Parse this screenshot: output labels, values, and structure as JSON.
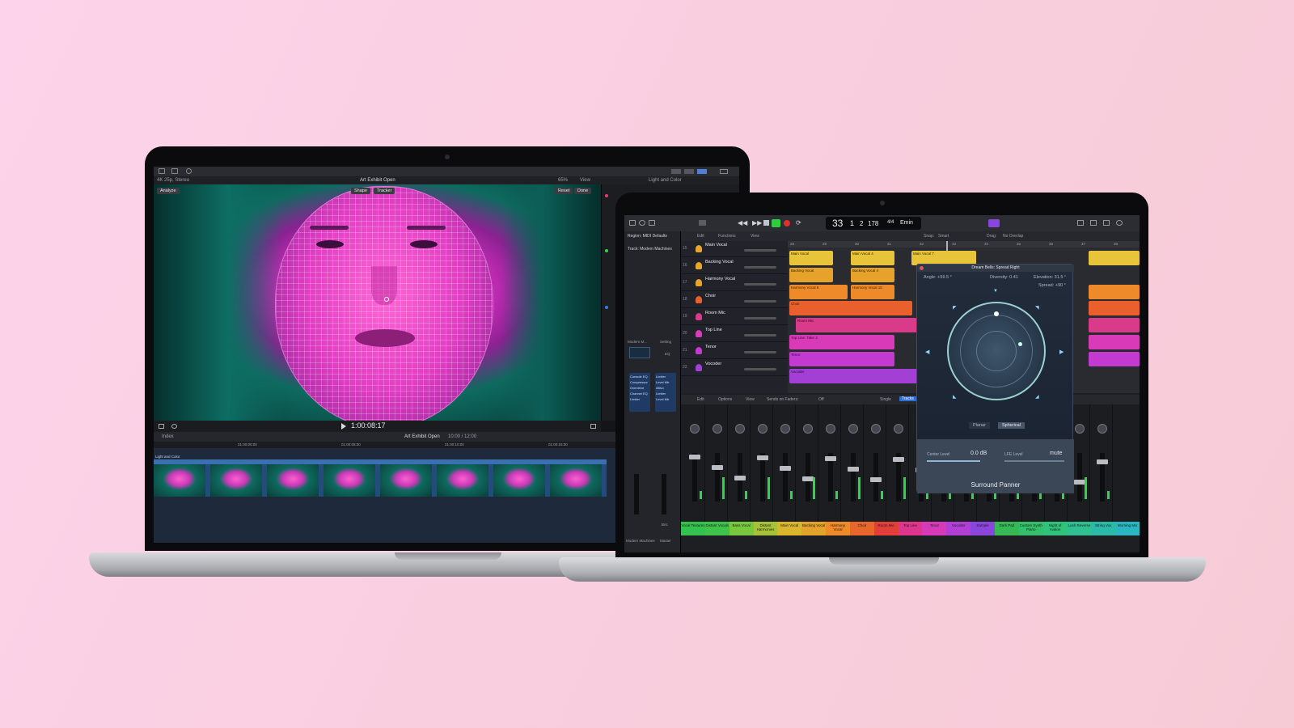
{
  "fcp": {
    "format": "4K 25p, Stereo",
    "project": "Art Exhibit Open",
    "zoom": "65%",
    "view_menu": "View",
    "inspector_title": "Light and Color",
    "analyze_label": "Analyze",
    "shape_label": "Shape",
    "tracker_label": "Tracker",
    "reset_label": "Reset",
    "done_label": "Done",
    "timecode": "1:00:08:17",
    "index_label": "Index",
    "timeline_project": "Art Exhibit Open",
    "timeline_duration": "10:00 / 12:00",
    "clip_label": "Light and Color",
    "ruler": [
      "01:00:00:00",
      "01:00:05:00",
      "01:00:10:00",
      "01:00:15:00"
    ]
  },
  "logic": {
    "lcd": {
      "bar": "33",
      "beat": "1",
      "div": "2",
      "tempo": "178",
      "sig": "4/4",
      "key": "Emin"
    },
    "inspector": {
      "region": "Region: MIDI Defaults",
      "track": "Track: Modern Machines",
      "preset": "Modern M...",
      "setting": "Setting",
      "eq": "EQ"
    },
    "plugins": [
      "Console EQ",
      "Compressor",
      "Overdrive",
      "Channel EQ",
      "Limiter"
    ],
    "plugins2": [
      "Limiter",
      "Level Mtr",
      "Altivo",
      "Limiter",
      "Level Mtr"
    ],
    "menus": {
      "edit": "Edit",
      "functions": "Functions",
      "view": "View",
      "snap": "Snap:",
      "snap_val": "Smart",
      "drag": "Drag:",
      "drag_val": "No Overlap"
    },
    "tracks": [
      {
        "num": "15",
        "name": "Main Vocal"
      },
      {
        "num": "16",
        "name": "Backing Vocal"
      },
      {
        "num": "17",
        "name": "Harmony Vocal"
      },
      {
        "num": "18",
        "name": "Choir"
      },
      {
        "num": "19",
        "name": "Room Mic"
      },
      {
        "num": "20",
        "name": "Top Line"
      },
      {
        "num": "21",
        "name": "Tenor"
      },
      {
        "num": "22",
        "name": "Vocoder"
      }
    ],
    "ruler": [
      "28",
      "29",
      "30",
      "31",
      "32",
      "33",
      "34",
      "35",
      "36",
      "37",
      "38"
    ],
    "regions": {
      "main_vocal": "Main Vocal",
      "main_vocal_4": "Main Vocal 4",
      "main_vocal_7": "Main Vocal 7",
      "backing": "Backing Vocal",
      "backing_4": "Backing Vocal 4",
      "harmony_8": "Harmony Vocal 8",
      "harmony_10": "Harmony Vocal 10",
      "choir": "Choir",
      "room": "Room Mic",
      "topline": "Top Line: Take 3",
      "tenor": "Tenor",
      "vocoder": "Vocoder"
    },
    "mixer_menus": {
      "edit": "Edit",
      "options": "Options",
      "view": "View",
      "sends": "Sends on Faders:",
      "sends_val": "Off",
      "single": "Single",
      "tracks": "Tracks"
    },
    "strip_names": [
      "Vocal Textures",
      "Distant Vocals",
      "Bass Vocal",
      "Distant Harmonies",
      "Main Vocal",
      "Backing Vocal",
      "Harmony Vocal",
      "Choir",
      "Room Mic",
      "Top Line",
      "Tenor",
      "Vocoder",
      "Sample",
      "Dark Pad",
      "Custom Synth Piano",
      "Night of Avalon",
      "Lush Reverse",
      "String Vox",
      "Morning Mix"
    ],
    "strip_colors": [
      "#33c24d",
      "#3fc24a",
      "#77c83c",
      "#a6c236",
      "#d9b62c",
      "#e3a229",
      "#ee8a2a",
      "#e8662c",
      "#e33f3a",
      "#e0358c",
      "#d63ab8",
      "#b13fd6",
      "#8a45dc",
      "#36b854",
      "#34c06a",
      "#30c27a",
      "#2fbf91",
      "#2cbaa8",
      "#2ab6c0"
    ],
    "master_labels": {
      "left": "Modern Machines",
      "right": "Master",
      "bnc": "Bnc"
    },
    "panner": {
      "title": "Dream Bells: Spread Right",
      "angle": "Angle: +59.5 °",
      "diversity": "Diversity: 0.41",
      "elevation": "Elevation: 31.5 °",
      "spread": "Spread: +90 °",
      "planar": "Planar",
      "spherical": "Spherical",
      "center_label": "Center Level",
      "center_val": "0.0 dB",
      "lfe_label": "LFE Level",
      "lfe_val": "mute",
      "footer": "Surround Panner"
    }
  }
}
